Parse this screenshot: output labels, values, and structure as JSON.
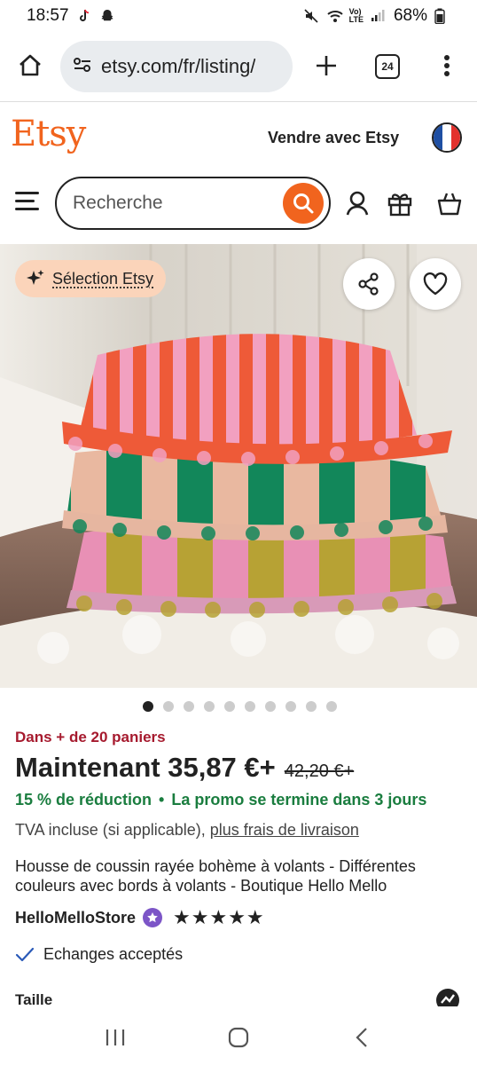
{
  "status_bar": {
    "time": "18:57",
    "battery": "68%"
  },
  "browser": {
    "url": "etsy.com/fr/listing/",
    "tab_count": "24"
  },
  "header": {
    "logo": "Etsy",
    "sell_label": "Vendre avec Etsy"
  },
  "search": {
    "placeholder": "Recherche"
  },
  "product": {
    "badge": "Sélection Etsy",
    "image_count": 10,
    "active_image": 1,
    "basket_info": "Dans + de 20 paniers",
    "price": "Maintenant 35,87 €+",
    "old_price": "42,20 €+",
    "discount": "15 % de réduction",
    "promo_end": "La promo se termine dans 3 jours",
    "promo_separator": "•",
    "tva": "TVA incluse (si applicable),",
    "shipping_link": "plus frais de livraison",
    "title": "Housse de coussin rayée bohème à volants - Différentes couleurs avec bords à volants - Boutique Hello Mello",
    "shop_name": "HelloMelloStore",
    "rating_stars": "★★★★★",
    "exchange": "Echanges acceptés",
    "size_label": "Taille"
  },
  "colors": {
    "accent": "#f1641e",
    "promo": "#1a7d3f",
    "basket": "#a61a2e",
    "badge_bg": "#fbd4ba"
  }
}
